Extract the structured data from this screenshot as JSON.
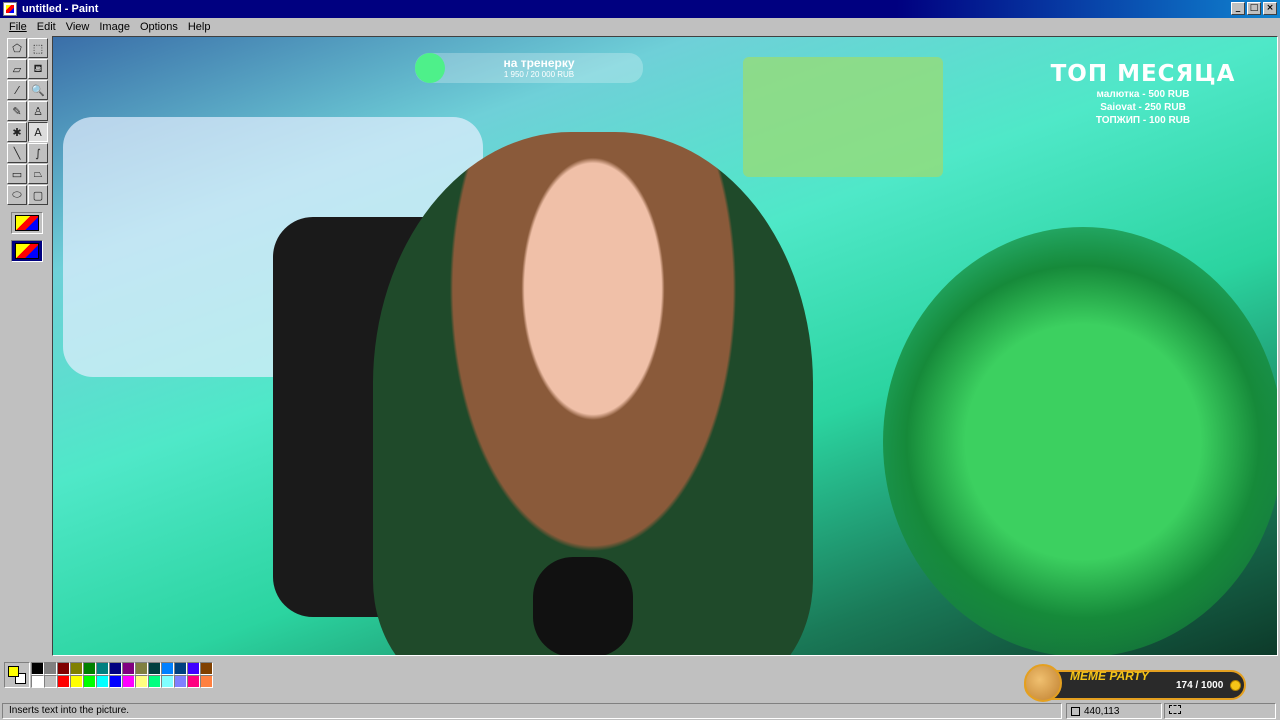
{
  "window": {
    "title": "untitled - Paint",
    "buttons": {
      "minimize": "_",
      "maximize": "□",
      "close": "×"
    }
  },
  "menu": [
    "File",
    "Edit",
    "View",
    "Image",
    "Options",
    "Help"
  ],
  "toolbox": {
    "tools": [
      {
        "name": "free-form-select-icon",
        "glyph": "⬠"
      },
      {
        "name": "select-icon",
        "glyph": "⬚"
      },
      {
        "name": "eraser-icon",
        "glyph": "▱"
      },
      {
        "name": "fill-bucket-icon",
        "glyph": "⛾"
      },
      {
        "name": "pick-color-icon",
        "glyph": "⁄"
      },
      {
        "name": "magnifier-icon",
        "glyph": "🔍"
      },
      {
        "name": "pencil-icon",
        "glyph": "✎"
      },
      {
        "name": "brush-icon",
        "glyph": "♙"
      },
      {
        "name": "airbrush-icon",
        "glyph": "✱"
      },
      {
        "name": "text-icon",
        "glyph": "A"
      },
      {
        "name": "line-icon",
        "glyph": "╲"
      },
      {
        "name": "curve-icon",
        "glyph": "∫"
      },
      {
        "name": "rectangle-icon",
        "glyph": "▭"
      },
      {
        "name": "polygon-icon",
        "glyph": "⏢"
      },
      {
        "name": "ellipse-icon",
        "glyph": "⬭"
      },
      {
        "name": "rounded-rectangle-icon",
        "glyph": "▢"
      }
    ],
    "selected_tool": "text-icon"
  },
  "canvas": {
    "goal_title": "на тренерку",
    "goal_amount": "1 950 / 20 000 RUB",
    "top_title": "ТОП МЕСЯЦА",
    "top_donors": [
      "малютка - 500 RUB",
      "Saiovat - 250 RUB",
      "ТОПЖИП - 100 RUB"
    ]
  },
  "meme_party": {
    "title": "MEME PARTY",
    "progress": "174 / 1000"
  },
  "palette": {
    "foreground": "#ffff00",
    "background": "#ffffff",
    "colors": [
      "#000000",
      "#808080",
      "#800000",
      "#808000",
      "#008000",
      "#008080",
      "#000080",
      "#800080",
      "#808040",
      "#004040",
      "#0080ff",
      "#004080",
      "#4000ff",
      "#804000",
      "#ffffff",
      "#c0c0c0",
      "#ff0000",
      "#ffff00",
      "#00ff00",
      "#00ffff",
      "#0000ff",
      "#ff00ff",
      "#ffff80",
      "#00ff80",
      "#80ffff",
      "#8080ff",
      "#ff0080",
      "#ff8040"
    ]
  },
  "status": {
    "message": "Inserts text into the picture.",
    "position": "440,113"
  }
}
